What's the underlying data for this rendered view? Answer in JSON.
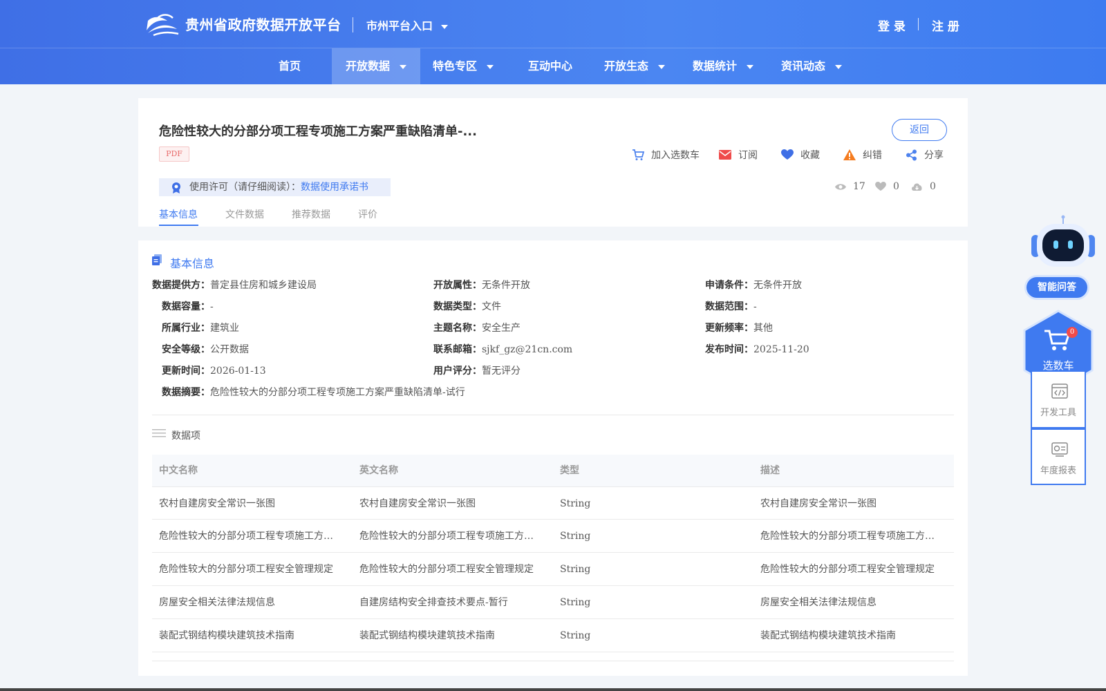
{
  "header": {
    "brand": "贵州省政府数据开放平台",
    "city_entry": "市州平台入口",
    "login": "登 录",
    "separator": "|",
    "register": "注 册"
  },
  "nav": {
    "items": [
      {
        "label": "首页"
      },
      {
        "label": "开放数据"
      },
      {
        "label": "特色专区"
      },
      {
        "label": "互动中心"
      },
      {
        "label": "开放生态"
      },
      {
        "label": "数据统计"
      },
      {
        "label": "资讯动态"
      }
    ]
  },
  "dataset": {
    "title": "危险性较大的分部分项工程专项施工方案严重缺陷清单-...",
    "format_badge": "PDF",
    "back_label": "返回",
    "actions": {
      "cart": "加入选数车",
      "subscribe": "订阅",
      "favorite": "收藏",
      "report": "纠错",
      "share": "分享"
    },
    "license_prefix": "使用许可（请仔细阅读）：",
    "license_link": "数据使用承诺书",
    "stats": {
      "views": "17",
      "likes": "0",
      "downloads": "0"
    },
    "tabs": [
      "基本信息",
      "文件数据",
      "推荐数据",
      "评价"
    ]
  },
  "basic_info": {
    "section_title": "基本信息",
    "fields": [
      {
        "k": "数据提供方：",
        "v": "普定县住房和城乡建设局"
      },
      {
        "k": "开放属性：",
        "v": "无条件开放"
      },
      {
        "k": "申请条件：",
        "v": "无条件开放"
      },
      {
        "k": "数据容量：",
        "v": "-"
      },
      {
        "k": "数据类型：",
        "v": "文件"
      },
      {
        "k": "数据范围：",
        "v": "-"
      },
      {
        "k": "所属行业：",
        "v": "建筑业"
      },
      {
        "k": "主题名称：",
        "v": "安全生产"
      },
      {
        "k": "更新频率：",
        "v": "其他"
      },
      {
        "k": "安全等级：",
        "v": "公开数据"
      },
      {
        "k": "联系邮箱：",
        "v": "sjkf_gz@21cn.com"
      },
      {
        "k": "发布时间：",
        "v": "2025-11-20"
      },
      {
        "k": "更新时间：",
        "v": "2026-01-13"
      },
      {
        "k": "用户评分：",
        "v": "暂无评分"
      },
      {
        "k": "数据摘要：",
        "v": "危险性较大的分部分项工程专项施工方案严重缺陷清单-试行"
      }
    ]
  },
  "data_items": {
    "section_title": "数据项",
    "columns": [
      "中文名称",
      "英文名称",
      "类型",
      "描述"
    ],
    "rows": [
      [
        "农村自建房安全常识一张图",
        "农村自建房安全常识一张图",
        "String",
        "农村自建房安全常识一张图"
      ],
      [
        "危险性较大的分部分项工程专项施工方案...",
        "危险性较大的分部分项工程专项施工方案...",
        "String",
        "危险性较大的分部分项工程专项施工方案..."
      ],
      [
        "危险性较大的分部分项工程安全管理规定",
        "危险性较大的分部分项工程安全管理规定",
        "String",
        "危险性较大的分部分项工程安全管理规定"
      ],
      [
        "房屋安全相关法律法规信息",
        "自建房结构安全排查技术要点-暂行",
        "String",
        "房屋安全相关法律法规信息"
      ],
      [
        "装配式钢结构模块建筑技术指南",
        "装配式钢结构模块建筑技术指南",
        "String",
        "装配式钢结构模块建筑技术指南"
      ]
    ]
  },
  "sidebar": {
    "ai_label": "智能问答",
    "cart_label": "选数车",
    "cart_count": "0",
    "dev_tools": "开发工具",
    "annual_report": "年度报表"
  },
  "colors": {
    "primary": "#3f7af0",
    "header": "#4b86f2",
    "danger": "#f24b4b",
    "warning": "#f57c1f"
  },
  "icons": [
    "logo-icon",
    "cart-icon",
    "mail-icon",
    "heart-icon",
    "warning-icon",
    "share-icon",
    "badge-icon",
    "eye-icon",
    "like-icon",
    "cloud-download-icon",
    "document-icon",
    "list-icon",
    "robot-icon",
    "code-icon",
    "report-icon"
  ]
}
